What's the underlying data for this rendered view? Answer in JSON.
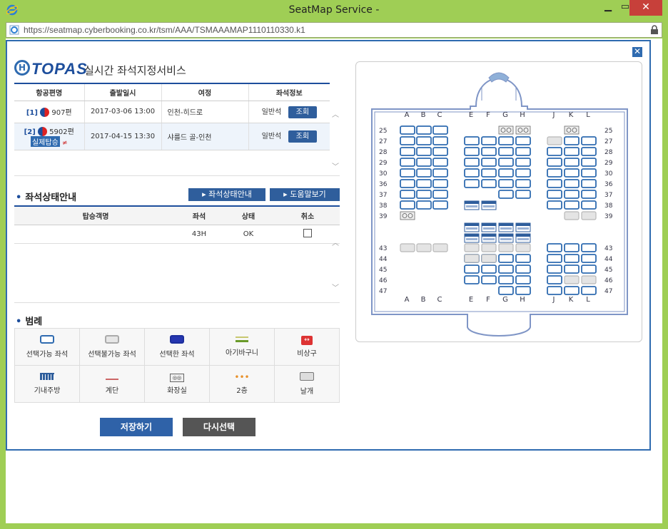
{
  "window": {
    "title": "SeatMap Service -",
    "url": "https://seatmap.cyberbooking.co.kr/tsm/AAA/TSMAAAMAP1110110330.k1"
  },
  "header": {
    "brand": "TOPAS",
    "subtitle": "실시간 좌석지정서비스"
  },
  "flights": {
    "columns": [
      "항공편명",
      "출발일시",
      "여정",
      "좌석정보"
    ],
    "rows": [
      {
        "index": "[1]",
        "flight": "907편",
        "departure": "2017-03-06 13:00",
        "route": "인천-히드로",
        "class": "일반석",
        "button": "조회"
      },
      {
        "index": "[2]",
        "flight": "5902편",
        "codeshare": "실제탑승",
        "departure": "2017-04-15 13:30",
        "route": "샤를드 골-인천",
        "class": "일반석",
        "button": "조회"
      }
    ]
  },
  "seat_status": {
    "title": "좌석상태안내",
    "guide_button": "좌석상태안내",
    "help_button": "도움말보기",
    "columns": [
      "탑승객명",
      "좌석",
      "상태",
      "취소"
    ],
    "rows": [
      {
        "name": "",
        "seat": "43H",
        "status": "OK"
      }
    ]
  },
  "legend": {
    "title": "범례",
    "items": [
      "선택가능 좌석",
      "선택불가능 좌석",
      "선택한 좌석",
      "아기바구니",
      "비상구",
      "기내주방",
      "계단",
      "화장실",
      "2층",
      "날개"
    ]
  },
  "actions": {
    "save": "저장하기",
    "reset": "다시선택"
  },
  "seatmap": {
    "columns_left": [
      "A",
      "B",
      "C"
    ],
    "columns_mid": [
      "E",
      "F",
      "G",
      "H"
    ],
    "columns_right": [
      "J",
      "K",
      "L"
    ],
    "rows": [
      "25",
      "27",
      "28",
      "29",
      "30",
      "36",
      "37",
      "38",
      "39",
      "43",
      "44",
      "45",
      "46",
      "47"
    ],
    "icons": {
      "toilet": "toilet-icon",
      "galley": "galley-icon"
    },
    "colors": {
      "available": "#2f6bb0",
      "unavailable": "#b8b8b8",
      "outline": "#7f95c6"
    }
  }
}
